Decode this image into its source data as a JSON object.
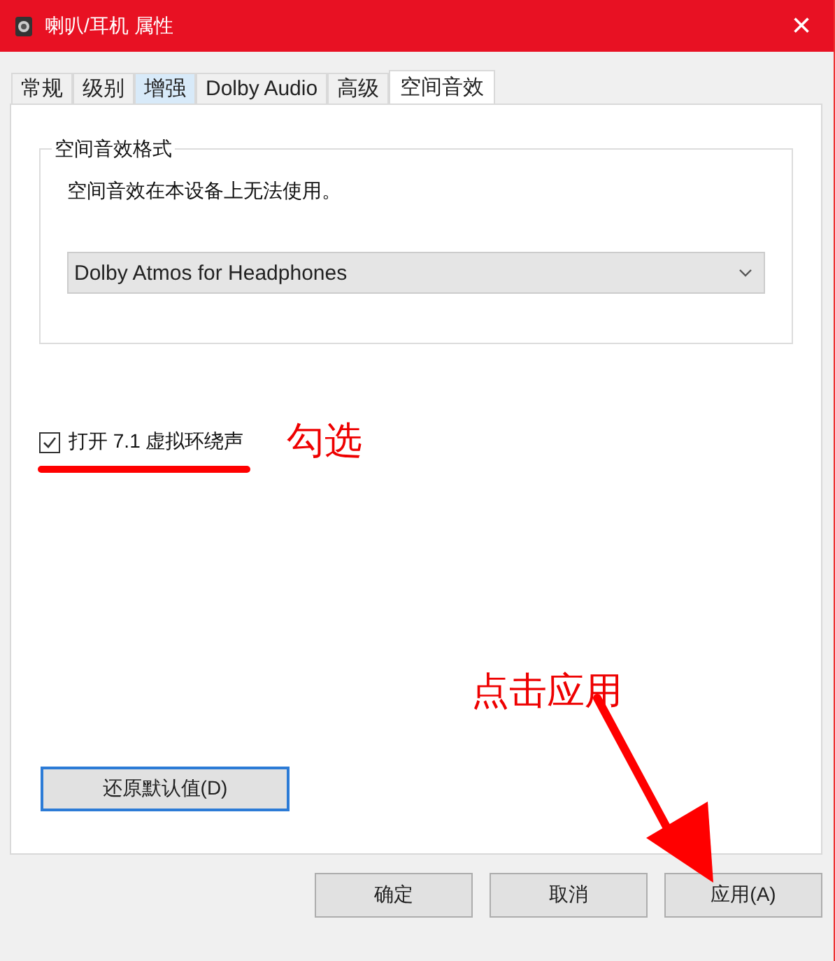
{
  "window": {
    "title": "喇叭/耳机 属性",
    "close": "×"
  },
  "tabs": [
    {
      "label": "常规",
      "selected": false,
      "highlighted": false
    },
    {
      "label": "级别",
      "selected": false,
      "highlighted": false
    },
    {
      "label": "增强",
      "selected": false,
      "highlighted": true
    },
    {
      "label": "Dolby Audio",
      "selected": false,
      "highlighted": false
    },
    {
      "label": "高级",
      "selected": false,
      "highlighted": false
    },
    {
      "label": "空间音效",
      "selected": true,
      "highlighted": false
    }
  ],
  "group": {
    "title": "空间音效格式",
    "message": "空间音效在本设备上无法使用。",
    "dropdown": {
      "value": "Dolby Atmos for Headphones",
      "disabled": true
    }
  },
  "checkbox": {
    "label": "打开 7.1 虚拟环绕声",
    "checked": true
  },
  "restore_button": "还原默认值(D)",
  "buttons": [
    "确定",
    "取消",
    "应用(A)"
  ],
  "annotations": [
    {
      "kind": "underlined-note",
      "text": "勾选"
    },
    {
      "kind": "arrow-note",
      "text": "点击应用"
    }
  ]
}
